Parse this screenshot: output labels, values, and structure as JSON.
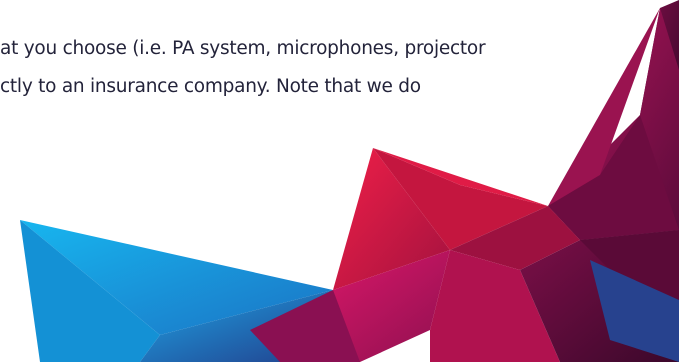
{
  "text": {
    "line_1": "at you choose (i.e. PA system, microphones, projector",
    "line_2": "ctly to an insurance company. Note that we do"
  },
  "colors": {
    "background": "#ffffff",
    "text": "#23233a",
    "crimson": "#c8173e",
    "magenta": "#8c1048",
    "dark_plum": "#4a0a32",
    "blue": "#1e8fd6",
    "light_blue": "#19b2ec",
    "navy": "#1d3f86"
  }
}
